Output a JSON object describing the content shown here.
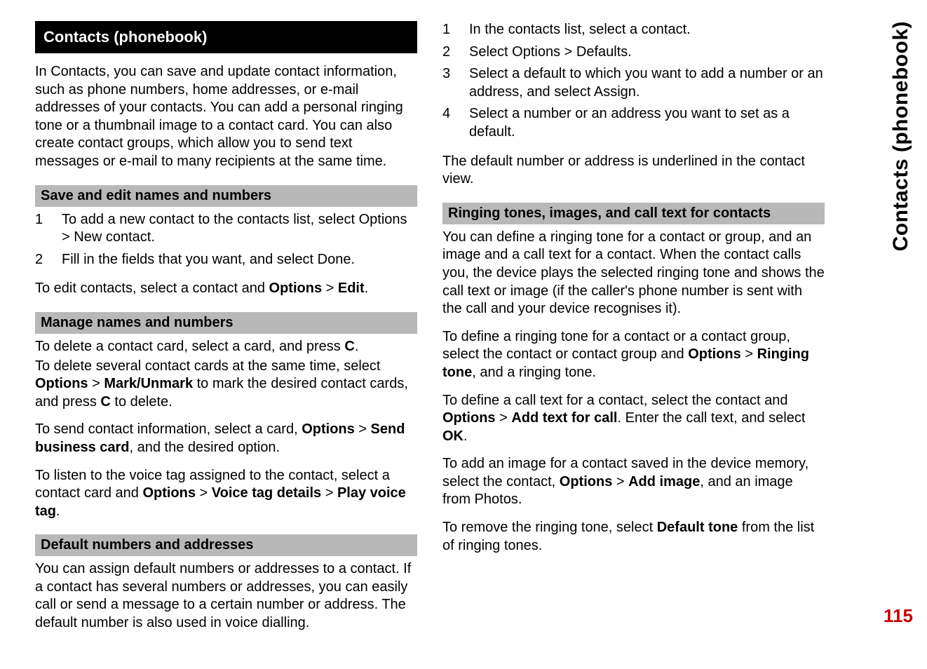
{
  "sideTab": "Contacts (phonebook)",
  "pageNumber": "115",
  "col1": {
    "mainHeading": "Contacts (phonebook)",
    "intro": "In Contacts, you can save and update contact information, such as phone numbers, home addresses, or e-mail addresses of your contacts. You can add a personal ringing tone or a thumbnail image to a contact card. You can also create contact groups, which allow you to send text messages or e-mail to many recipients at the same time.",
    "sec1": {
      "heading": "Save and edit names and numbers",
      "step1_a": "To add a new contact to the contacts list, select ",
      "step1_b1": "Options",
      "step1_gt": " > ",
      "step1_b2": "New contact",
      "step1_c": ".",
      "step2_a": "Fill in the fields that you want, and select ",
      "step2_b": "Done",
      "step2_c": ".",
      "para_a": "To edit contacts, select a contact and ",
      "para_b1": "Options",
      "para_gt": " > ",
      "para_b2": "Edit",
      "para_c": "."
    },
    "sec2": {
      "heading": "Manage names and numbers",
      "p1_a": "To delete a contact card, select a card, and press ",
      "p1_b": "C",
      "p1_c": ".",
      "p2_a": "To delete several contact cards at the same time, select ",
      "p2_b1": "Options",
      "p2_gt": " > ",
      "p2_b2": "Mark/Unmark",
      "p2_c": " to mark the desired contact cards, and press ",
      "p2_b3": "C",
      "p2_d": " to delete.",
      "p3_a": "To send contact information, select a card, ",
      "p3_b1": "Options",
      "p3_gt": " > ",
      "p3_b2": "Send business card",
      "p3_c": ", and the desired option.",
      "p4_a": "To listen to the voice tag assigned to the contact, select a contact card and ",
      "p4_b1": "Options",
      "p4_gt1": " > ",
      "p4_b2": "Voice tag details",
      "p4_gt2": " > ",
      "p4_b3": "Play voice tag",
      "p4_c": "."
    },
    "sec3": {
      "heading": "Default numbers and addresses",
      "p1": "You can assign default numbers or addresses to a contact. If a contact has several numbers or addresses, you can easily call or send a message to a certain number or address. The default number is also used in voice dialling."
    }
  },
  "col2": {
    "steps": {
      "s1": "In the contacts list, select a contact.",
      "s2_a": "Select ",
      "s2_b1": "Options",
      "s2_gt": " > ",
      "s2_b2": "Defaults",
      "s2_c": ".",
      "s3_a": "Select a default to which you want to add a number or an address, and select ",
      "s3_b": "Assign",
      "s3_c": ".",
      "s4": "Select a number or an address you want to set as a default."
    },
    "p1": "The default number or address is underlined in the contact view.",
    "sec1": {
      "heading": "Ringing tones, images, and call text for contacts",
      "p1": "You can define a ringing tone for a contact or group, and an image and a call text for a contact. When the contact calls you, the device plays the selected ringing tone and shows the call text or image (if the caller's phone number is sent with the call and your device recognises it).",
      "p2_a": "To define a ringing tone for a contact or a contact group, select the contact or contact group and ",
      "p2_b1": "Options",
      "p2_gt": " > ",
      "p2_b2": "Ringing tone",
      "p2_c": ", and a ringing tone.",
      "p3_a": "To define a call text for a contact, select the contact and ",
      "p3_b1": "Options",
      "p3_gt": " > ",
      "p3_b2": "Add text for call",
      "p3_c": ". Enter the call text, and select ",
      "p3_b3": "OK",
      "p3_d": ".",
      "p4_a": "To add an image for a contact saved in the device memory, select the contact, ",
      "p4_b1": "Options",
      "p4_gt": " > ",
      "p4_b2": "Add image",
      "p4_c": ", and an image from Photos.",
      "p5_a": "To remove the ringing tone, select ",
      "p5_b": "Default tone",
      "p5_c": " from the list of ringing tones."
    }
  }
}
